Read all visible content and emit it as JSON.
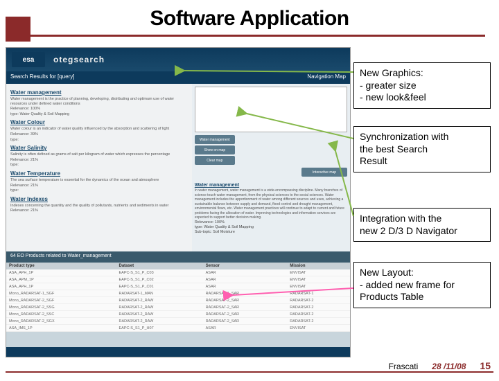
{
  "title": "Software Application",
  "app": {
    "logo1": "esa",
    "logo2": "otegsearch",
    "search_banner_left": "Search Results for [query]",
    "search_banner_right": "Navigation Map",
    "left": {
      "sections": [
        {
          "h": "Water management",
          "p1": "Water management is the practice of planning, developing, distributing and optimum use of water resources under defined water conditions",
          "rel": "Relevance: 100%",
          "typ": "type: Water Quality & Soil Mapping"
        },
        {
          "h": "Water Colour",
          "p1": "Water colour is an indicator of water quality influenced by the absorption and scattering of light",
          "rel": "Relevance: 39%",
          "typ": "type:"
        },
        {
          "h": "Water Salinity",
          "p1": "Salinity is often defined as grams of salt per kilogram of water which expresses the percentage",
          "rel": "Relevance: 21%",
          "typ": "type:"
        },
        {
          "h": "Water Temperature",
          "p1": "The sea surface temperature is essential for the dynamics of the ocean and atmosphere",
          "rel": "Relevance: 21%",
          "typ": "type:"
        },
        {
          "h": "Water Indexes",
          "p1": "Indexes concerning the quantity and the quality of pollutants, nutrients and sediments in water",
          "rel": "Relevance: 21%"
        }
      ]
    },
    "right": {
      "btn1": "Water management",
      "btn2": "Show on map",
      "btn3": "Clear map",
      "btn4": "Interactive map",
      "panel_h": "Water management",
      "panel_p": "In water management, water management is a wide-encompassing discipline. Many branches of science touch water management, from the physical sciences to the social sciences. Water management includes the apportionment of water among different sources and uses, achieving a sustainable balance between supply and demand, flood control and drought management, environmental flows, etc. Water management practices will continue to adapt to current and future problems facing the allocation of water. Improving technologies and information services are expected to support better decision making.",
      "rel": "Relevance: 100%",
      "typ": "type: Water Quality & Soil Mapping",
      "typ2": "Sub-topic: Soil Moisture"
    },
    "products": {
      "header": "64 EO Products related to Water_management",
      "cols": [
        "Product type",
        "Dataset",
        "Sensor",
        "Mission"
      ],
      "rows": [
        [
          "ASA_APH_1P",
          "EAPC-S_S1_P_C03",
          "ASAR",
          "ENVISAT"
        ],
        [
          "ASA_APM_1P",
          "EAPC-S_S1_P_C02",
          "ASAR",
          "ENVISAT"
        ],
        [
          "ASA_APH_1P",
          "EAPC-S_S1_P_C01",
          "ASAR",
          "ENVISAT"
        ],
        [
          "Mono_RADARSAT-1_SGF",
          "RADARSAT-1_MAN",
          "RADARSAT-1_SAR",
          "RADARSAT-1"
        ],
        [
          "Mono_RADARSAT-2_SGF",
          "RADARSAT-2_RAW",
          "RADARSAT-2_SAR",
          "RADARSAT-2"
        ],
        [
          "Mono_RADARSAT-2_SSG",
          "RADARSAT-2_RAW",
          "RADARSAT-2_SAR",
          "RADARSAT-2"
        ],
        [
          "Mono_RADARSAT-2_SSC",
          "RADARSAT-2_RAW",
          "RADARSAT-2_SAR",
          "RADARSAT-2"
        ],
        [
          "Mono_RADARSAT-2_SGX",
          "RADARSAT-2_RAW",
          "RADARSAT-2_SAR",
          "RADARSAT-2"
        ],
        [
          "ASA_IMS_1P",
          "EAPC-S_S1_P_H07",
          "ASAR",
          "ENVISAT"
        ]
      ]
    }
  },
  "callouts": {
    "c1_l1": "New Graphics:",
    "c1_l2": "- greater size",
    "c1_l3": "- new look&feel",
    "c2_l1": "Synchronization with",
    "c2_l2": "the best Search",
    "c2_l3": "Result",
    "c3_l1": "Integration with the",
    "c3_l2": "new 2 D/3 D Navigator",
    "c4_l1": "New Layout:",
    "c4_l2": "- added new frame for",
    "c4_l3": "Products Table"
  },
  "footer": {
    "location": "Frascati",
    "date": "28 /11/08",
    "page": "15"
  }
}
